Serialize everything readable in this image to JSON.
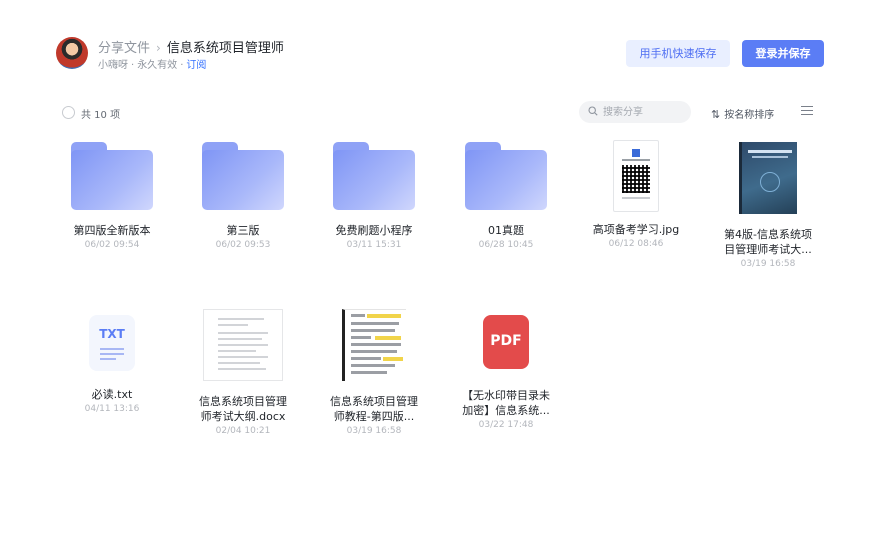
{
  "header": {
    "breadcrumb_parent": "分享文件",
    "breadcrumb_sep": "›",
    "title": "信息系统项目管理师",
    "owner": "小嗨呀",
    "validity": "永久有效",
    "meta_sep": "·",
    "subscribe": "订阅",
    "btn_phone_save": "用手机快速保存",
    "btn_login_save": "登录并保存"
  },
  "toolbar": {
    "count": "共 10 项",
    "search_placeholder": "搜索分享",
    "sort_label": "按名称排序",
    "sort_icon": "⇅"
  },
  "icons": {
    "folder_color": "#8fa2f6",
    "accent": "#5b7df5",
    "pdf_color": "#e34b4b"
  },
  "files": [
    {
      "name": "第四版全新版本",
      "date": "06/02 09:54",
      "type": "folder"
    },
    {
      "name": "第三版",
      "date": "06/02 09:53",
      "type": "folder"
    },
    {
      "name": "免费刷题小程序",
      "date": "03/11 15:31",
      "type": "folder"
    },
    {
      "name": "01真题",
      "date": "06/28 10:45",
      "type": "folder"
    },
    {
      "name": "高项备考学习.jpg",
      "date": "06/12 08:46",
      "type": "image"
    },
    {
      "name1": "第4版-信息系统项",
      "name2": "目管理师考试大...",
      "date": "03/19 16:58",
      "type": "image"
    },
    {
      "name": "必读.txt",
      "date": "04/11 13:16",
      "type": "txt",
      "icon_label": "TXT"
    },
    {
      "name1": "信息系统项目管理",
      "name2": "师考试大纲.docx",
      "date": "02/04 10:21",
      "type": "docx"
    },
    {
      "name1": "信息系统项目管理",
      "name2": "师教程-第四版...",
      "date": "03/19 16:58",
      "type": "ebook"
    },
    {
      "name1": "【无水印带目录未",
      "name2": "加密】信息系统...",
      "date": "03/22 17:48",
      "type": "pdf",
      "icon_label": "PDF"
    }
  ]
}
